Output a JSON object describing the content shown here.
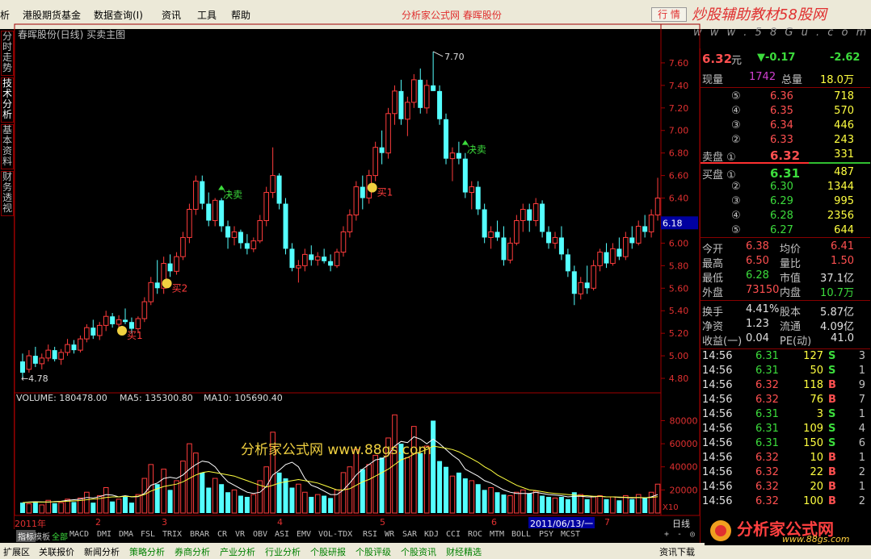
{
  "menu": {
    "items": [
      "析",
      "港股期货基金",
      "数据查询(I)",
      "资讯",
      "工具",
      "帮助"
    ],
    "app_title": "分析家公式网 春晖股份",
    "trade_button": "行 情",
    "watermark_top": "炒股辅助教材58股网",
    "watermark_url": "w w w . 5 8 G u . c o m"
  },
  "left_tabs": [
    "分时走势",
    "技术分析",
    "基本资料",
    "财务透视"
  ],
  "chart": {
    "title": "春晖股份(日线) 买卖主图",
    "price_axis": [
      "7.60",
      "7.40",
      "7.20",
      "7.00",
      "6.80",
      "6.60",
      "6.40",
      "6.20",
      "6.00",
      "5.80",
      "5.60",
      "5.40",
      "5.20",
      "5.00",
      "4.80"
    ],
    "current_price_tag": "6.18",
    "high_label": "7.70",
    "low_label": "4.78",
    "signals": [
      {
        "text": "买1",
        "type": "buy"
      },
      {
        "text": "买2",
        "type": "buy"
      },
      {
        "text": "决卖",
        "type": "sell"
      },
      {
        "text": "买1",
        "type": "buy"
      },
      {
        "text": "决卖",
        "type": "sell"
      }
    ],
    "volume_header": {
      "volume": "VOLUME: 180478.00",
      "ma5": "MA5: 135300.80",
      "ma10": "MA10: 105690.40"
    },
    "volume_axis": [
      "80000",
      "60000",
      "40000",
      "20000"
    ],
    "volume_unit": "X10",
    "volume_watermark": "分析家公式网 www.88gs.com",
    "time_axis": [
      "2011年",
      "2",
      "3",
      "4",
      "5",
      "6",
      "2011/06/13/一",
      "7"
    ],
    "period_label": "日线"
  },
  "bottom_tabs": [
    "指标",
    "模板",
    "全部",
    "MACD",
    "DMI",
    "DMA",
    "FSL",
    "TRIX",
    "BRAR",
    "CR",
    "VR",
    "OBV",
    "ASI",
    "EMV",
    "VOL-TDX",
    "RSI",
    "WR",
    "SAR",
    "KDJ",
    "CCI",
    "ROC",
    "MTM",
    "BOLL",
    "PSY",
    "MCST"
  ],
  "bottom_controls": [
    "+",
    "-",
    "◎"
  ],
  "bottom_bar": [
    "扩展区",
    "关联报价",
    "新闻分析",
    "策略分析",
    "券商分析",
    "产业分析",
    "行业分析",
    "个股研报",
    "个股评级",
    "个股资讯",
    "财经精选",
    "资讯下载"
  ],
  "quote": {
    "price": "6.32",
    "price_unit": "元",
    "change": "▼-0.17",
    "change_pct": "-2.62",
    "current_vol_label": "现量",
    "current_vol": "1742",
    "total_vol_label": "总量",
    "total_vol": "18.0万",
    "sell": [
      {
        "level": "⑤",
        "price": "6.36",
        "vol": "718"
      },
      {
        "level": "④",
        "price": "6.35",
        "vol": "570"
      },
      {
        "level": "③",
        "price": "6.34",
        "vol": "446"
      },
      {
        "level": "②",
        "price": "6.33",
        "vol": "243"
      },
      {
        "level": "卖盘 ①",
        "price": "6.32",
        "vol": "331"
      }
    ],
    "buy": [
      {
        "level": "买盘 ①",
        "price": "6.31",
        "vol": "487"
      },
      {
        "level": "②",
        "price": "6.30",
        "vol": "1344"
      },
      {
        "level": "③",
        "price": "6.29",
        "vol": "995"
      },
      {
        "level": "④",
        "price": "6.28",
        "vol": "2356"
      },
      {
        "level": "⑤",
        "price": "6.27",
        "vol": "644"
      }
    ],
    "stats": [
      {
        "l1": "今开",
        "v1": "6.38",
        "l2": "均价",
        "v2": "6.41"
      },
      {
        "l1": "最高",
        "v1": "6.50",
        "l2": "量比",
        "v2": "1.50"
      },
      {
        "l1": "最低",
        "v1": "6.28",
        "l2": "市值",
        "v2": "37.1亿"
      },
      {
        "l1": "外盘",
        "v1": "73150",
        "l2": "内盘",
        "v2": "10.7万"
      }
    ],
    "stats2": [
      {
        "l1": "换手",
        "v1": "4.41%",
        "l2": "股本",
        "v2": "5.87亿"
      },
      {
        "l1": "净资",
        "v1": "1.23",
        "l2": "流通",
        "v2": "4.09亿"
      },
      {
        "l1": "收益(一)",
        "v1": "0.04",
        "l2": "PE(动)",
        "v2": "41.0"
      }
    ],
    "ticks": [
      {
        "time": "14:56",
        "price": "6.31",
        "vol": "127",
        "side": "S",
        "n": "3"
      },
      {
        "time": "14:56",
        "price": "6.31",
        "vol": "50",
        "side": "S",
        "n": "1"
      },
      {
        "time": "14:56",
        "price": "6.32",
        "vol": "118",
        "side": "B",
        "n": "9"
      },
      {
        "time": "14:56",
        "price": "6.32",
        "vol": "76",
        "side": "B",
        "n": "7"
      },
      {
        "time": "14:56",
        "price": "6.31",
        "vol": "3",
        "side": "S",
        "n": "1"
      },
      {
        "time": "14:56",
        "price": "6.31",
        "vol": "109",
        "side": "S",
        "n": "4"
      },
      {
        "time": "14:56",
        "price": "6.31",
        "vol": "150",
        "side": "S",
        "n": "6"
      },
      {
        "time": "14:56",
        "price": "6.32",
        "vol": "10",
        "side": "B",
        "n": "1"
      },
      {
        "time": "14:56",
        "price": "6.32",
        "vol": "22",
        "side": "B",
        "n": "2"
      },
      {
        "time": "14:56",
        "price": "6.32",
        "vol": "20",
        "side": "B",
        "n": "1"
      },
      {
        "time": "14:56",
        "price": "6.32",
        "vol": "100",
        "side": "B",
        "n": "2"
      }
    ]
  },
  "logo_text": "分析家公式网",
  "logo_url": "www.88gs.com",
  "chart_data": {
    "type": "candlestick",
    "title": "春晖股份(日线) 买卖主图",
    "ylim": [
      4.7,
      7.8
    ],
    "volume_ylim": [
      0,
      95000
    ],
    "ohlc": [
      [
        4.95,
        5.02,
        4.8,
        4.85
      ],
      [
        4.88,
        5.05,
        4.85,
        5.0
      ],
      [
        5.0,
        5.08,
        4.9,
        4.93
      ],
      [
        4.93,
        5.02,
        4.88,
        4.98
      ],
      [
        4.98,
        5.1,
        4.95,
        5.05
      ],
      [
        5.05,
        5.08,
        4.95,
        4.97
      ],
      [
        4.97,
        5.06,
        4.92,
        5.03
      ],
      [
        5.03,
        5.15,
        5.0,
        5.1
      ],
      [
        5.1,
        5.14,
        5.02,
        5.05
      ],
      [
        5.05,
        5.18,
        5.03,
        5.15
      ],
      [
        5.15,
        5.28,
        5.12,
        5.25
      ],
      [
        5.25,
        5.32,
        5.15,
        5.18
      ],
      [
        5.18,
        5.3,
        5.14,
        5.27
      ],
      [
        5.27,
        5.4,
        5.22,
        5.35
      ],
      [
        5.35,
        5.38,
        5.25,
        5.28
      ],
      [
        5.28,
        5.36,
        5.22,
        5.32
      ],
      [
        5.32,
        5.42,
        5.28,
        5.3
      ],
      [
        5.3,
        5.34,
        5.2,
        5.24
      ],
      [
        5.24,
        5.35,
        5.2,
        5.33
      ],
      [
        5.33,
        5.52,
        5.3,
        5.48
      ],
      [
        5.48,
        5.7,
        5.45,
        5.65
      ],
      [
        5.65,
        5.85,
        5.55,
        5.6
      ],
      [
        5.6,
        5.88,
        5.55,
        5.82
      ],
      [
        5.82,
        5.9,
        5.7,
        5.75
      ],
      [
        5.75,
        5.92,
        5.72,
        5.88
      ],
      [
        5.88,
        6.1,
        5.85,
        6.05
      ],
      [
        6.05,
        6.35,
        6.0,
        6.3
      ],
      [
        6.3,
        6.6,
        6.25,
        6.55
      ],
      [
        6.55,
        6.6,
        6.3,
        6.35
      ],
      [
        6.35,
        6.45,
        6.15,
        6.2
      ],
      [
        6.2,
        6.4,
        6.15,
        6.38
      ],
      [
        6.38,
        6.4,
        6.1,
        6.15
      ],
      [
        6.15,
        6.2,
        5.95,
        6.05
      ],
      [
        6.05,
        6.15,
        5.98,
        6.1
      ],
      [
        6.1,
        6.12,
        5.95,
        6.0
      ],
      [
        6.0,
        6.08,
        5.9,
        5.95
      ],
      [
        5.95,
        6.05,
        5.92,
        6.02
      ],
      [
        6.02,
        6.25,
        6.0,
        6.2
      ],
      [
        6.2,
        6.5,
        6.15,
        6.45
      ],
      [
        6.45,
        6.85,
        6.4,
        6.6
      ],
      [
        6.6,
        6.62,
        6.3,
        6.35
      ],
      [
        6.35,
        6.4,
        5.9,
        5.95
      ],
      [
        5.95,
        6.0,
        5.75,
        5.78
      ],
      [
        5.78,
        5.85,
        5.65,
        5.8
      ],
      [
        5.8,
        5.95,
        5.75,
        5.9
      ],
      [
        5.9,
        5.98,
        5.8,
        5.85
      ],
      [
        5.85,
        5.92,
        5.8,
        5.88
      ],
      [
        5.88,
        5.95,
        5.82,
        5.84
      ],
      [
        5.84,
        5.9,
        5.75,
        5.8
      ],
      [
        5.8,
        5.95,
        5.78,
        5.92
      ],
      [
        5.92,
        6.15,
        5.88,
        6.1
      ],
      [
        6.1,
        6.3,
        6.05,
        6.25
      ],
      [
        6.25,
        6.55,
        6.2,
        6.5
      ],
      [
        6.5,
        6.6,
        6.3,
        6.4
      ],
      [
        6.4,
        6.65,
        6.35,
        6.6
      ],
      [
        6.6,
        6.9,
        6.55,
        6.85
      ],
      [
        6.85,
        7.0,
        6.7,
        6.8
      ],
      [
        6.8,
        7.2,
        6.75,
        7.15
      ],
      [
        7.15,
        7.4,
        7.05,
        7.35
      ],
      [
        7.35,
        7.45,
        7.05,
        7.1
      ],
      [
        7.1,
        7.3,
        6.95,
        7.25
      ],
      [
        7.25,
        7.5,
        7.2,
        7.45
      ],
      [
        7.45,
        7.55,
        7.15,
        7.2
      ],
      [
        7.2,
        7.45,
        7.15,
        7.4
      ],
      [
        7.4,
        7.7,
        7.35,
        7.35
      ],
      [
        7.35,
        7.4,
        7.05,
        7.1
      ],
      [
        7.1,
        7.15,
        6.7,
        6.75
      ],
      [
        6.75,
        6.85,
        6.55,
        6.8
      ],
      [
        6.8,
        6.9,
        6.7,
        6.75
      ],
      [
        6.75,
        6.8,
        6.4,
        6.45
      ],
      [
        6.45,
        6.55,
        6.3,
        6.5
      ],
      [
        6.5,
        6.55,
        6.25,
        6.3
      ],
      [
        6.3,
        6.35,
        6.0,
        6.05
      ],
      [
        6.05,
        6.15,
        5.95,
        6.1
      ],
      [
        6.1,
        6.2,
        6.02,
        6.05
      ],
      [
        6.05,
        6.15,
        5.8,
        5.85
      ],
      [
        5.85,
        6.05,
        5.82,
        6.0
      ],
      [
        6.0,
        6.25,
        5.98,
        6.2
      ],
      [
        6.2,
        6.35,
        6.1,
        6.3
      ],
      [
        6.3,
        6.35,
        6.1,
        6.2
      ],
      [
        6.2,
        6.4,
        6.15,
        6.35
      ],
      [
        6.35,
        6.38,
        6.05,
        6.1
      ],
      [
        6.1,
        6.15,
        5.95,
        6.0
      ],
      [
        6.0,
        6.1,
        5.95,
        6.05
      ],
      [
        6.05,
        6.15,
        5.85,
        5.9
      ],
      [
        5.9,
        5.95,
        5.7,
        5.75
      ],
      [
        5.75,
        5.8,
        5.45,
        5.55
      ],
      [
        5.55,
        5.7,
        5.5,
        5.65
      ],
      [
        5.65,
        5.8,
        5.55,
        5.6
      ],
      [
        5.6,
        5.85,
        5.58,
        5.8
      ],
      [
        5.8,
        5.95,
        5.75,
        5.92
      ],
      [
        5.92,
        6.0,
        5.78,
        5.82
      ],
      [
        5.82,
        6.0,
        5.8,
        5.95
      ],
      [
        5.95,
        6.05,
        5.85,
        5.88
      ],
      [
        5.88,
        6.1,
        5.85,
        6.05
      ],
      [
        6.05,
        6.15,
        5.95,
        6.0
      ],
      [
        6.0,
        6.2,
        5.98,
        6.15
      ],
      [
        6.15,
        6.25,
        6.05,
        6.1
      ],
      [
        6.1,
        6.3,
        6.05,
        6.25
      ],
      [
        6.25,
        6.58,
        6.2,
        6.4
      ]
    ],
    "volume": [
      9000,
      8000,
      10000,
      7000,
      11000,
      8500,
      9000,
      12000,
      9500,
      13000,
      18000,
      9000,
      15000,
      22000,
      10000,
      12000,
      14000,
      9000,
      16000,
      30000,
      42000,
      25000,
      38000,
      20000,
      28000,
      45000,
      60000,
      52000,
      35000,
      22000,
      30000,
      25000,
      18000,
      20000,
      15000,
      14000,
      16000,
      28000,
      40000,
      70000,
      35000,
      30000,
      22000,
      25000,
      18000,
      14000,
      16000,
      15000,
      13000,
      20000,
      35000,
      40000,
      55000,
      38000,
      42000,
      50000,
      48000,
      65000,
      85000,
      60000,
      48000,
      75000,
      52000,
      58000,
      80000,
      45000,
      40000,
      32000,
      35000,
      30000,
      28000,
      25000,
      20000,
      22000,
      18000,
      16000,
      15000,
      18000,
      20000,
      17000,
      19000,
      15000,
      14000,
      13000,
      14000,
      12000,
      18000,
      16000,
      12000,
      14000,
      15000,
      12000,
      14000,
      11000,
      15000,
      12000,
      16000,
      13000,
      18000,
      25000
    ],
    "volume_ma5": [
      9000,
      9500,
      9800,
      9600,
      9400,
      9900,
      10200,
      11000,
      11500,
      12000,
      13500,
      13000,
      14200,
      16000,
      15500,
      14000,
      15000,
      14000,
      14200,
      17000,
      24000,
      26000,
      30000,
      31000,
      30000,
      33000,
      38000,
      42000,
      45000,
      44000,
      40000,
      33000,
      27000,
      24000,
      21000,
      18000,
      17000,
      18000,
      23000,
      33000,
      37000,
      42000,
      44000,
      40000,
      30000,
      24000,
      22000,
      19000,
      16000,
      16000,
      20000,
      26000,
      33000,
      38000,
      42000,
      46000,
      47000,
      50000,
      58000,
      62000,
      61000,
      66000,
      64000,
      60000,
      64000,
      60000,
      55000,
      50000,
      46000,
      38000,
      35000,
      32000,
      28000,
      26000,
      23000,
      20000,
      18000,
      17000,
      17000,
      17000,
      18000,
      17000,
      16000,
      15500,
      15000,
      14000,
      14500,
      14500,
      14000,
      14000,
      14500,
      14000,
      14000,
      13500,
      13500,
      13000,
      13500,
      13000,
      14000,
      16000
    ],
    "volume_ma10": [
      9000,
      9200,
      9400,
      9500,
      9600,
      9700,
      9900,
      10200,
      10500,
      10800,
      11500,
      12000,
      12500,
      13500,
      14000,
      14000,
      14500,
      14200,
      14600,
      16000,
      19000,
      21000,
      23000,
      24000,
      25000,
      27000,
      30000,
      33000,
      35000,
      36000,
      35000,
      34000,
      33000,
      32000,
      30000,
      28000,
      26000,
      24000,
      22500,
      24000,
      26000,
      27000,
      28000,
      29000,
      28000,
      27000,
      26000,
      24000,
      22000,
      20000,
      20000,
      21000,
      24000,
      27000,
      29000,
      32000,
      35000,
      38000,
      42000,
      46000,
      48000,
      51000,
      53000,
      55000,
      58000,
      57000,
      56000,
      55000,
      53000,
      50000,
      47000,
      44000,
      40000,
      37000,
      33000,
      30000,
      27000,
      24000,
      22000,
      20000,
      19500,
      18500,
      17500,
      17000,
      16500,
      16000,
      15500,
      15000,
      15000,
      14500,
      14500,
      14000,
      14000,
      13800,
      13600,
      13500,
      13500,
      13300,
      13500,
      14200
    ]
  }
}
